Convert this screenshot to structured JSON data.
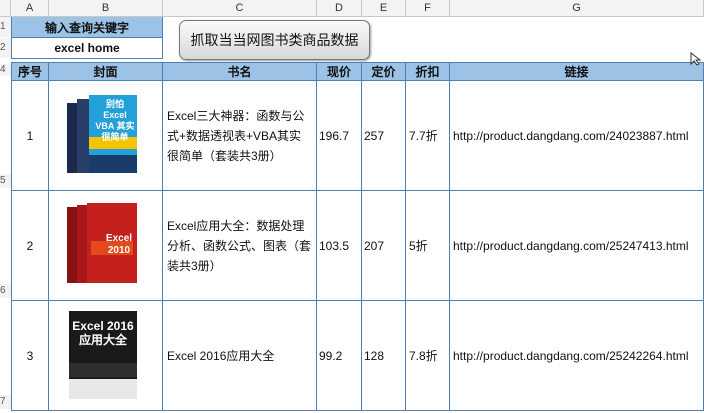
{
  "columns": [
    "A",
    "B",
    "C",
    "D",
    "E",
    "F",
    "G"
  ],
  "row_numbers": [
    "1",
    "2",
    "4",
    "5",
    "6",
    "7"
  ],
  "query": {
    "label": "输入查询关键字",
    "value": "excel home"
  },
  "button_label": "抓取当当网图书类商品数据",
  "table": {
    "headers": [
      "序号",
      "封面",
      "书名",
      "现价",
      "定价",
      "折扣",
      "链接"
    ],
    "rows": [
      {
        "no": "1",
        "title": "Excel三大神器：函数与公式+数据透视表+VBA其实很简单（套装共3册）",
        "price": "196.7",
        "list_price": "257",
        "discount": "7.7折",
        "link": "http://product.dangdang.com/24023887.html",
        "cover_text": "别怕 Excel VBA 其实很简单"
      },
      {
        "no": "2",
        "title": "Excel应用大全：数据处理分析、函数公式、图表（套装共3册）",
        "price": "103.5",
        "list_price": "207",
        "discount": "5折",
        "link": "http://product.dangdang.com/25247413.html",
        "cover_text": "Excel 2010"
      },
      {
        "no": "3",
        "title": "Excel 2016应用大全",
        "price": "99.2",
        "list_price": "128",
        "discount": "7.8折",
        "link": "http://product.dangdang.com/25242264.html",
        "cover_text": "Excel 2016 应用大全"
      }
    ]
  }
}
